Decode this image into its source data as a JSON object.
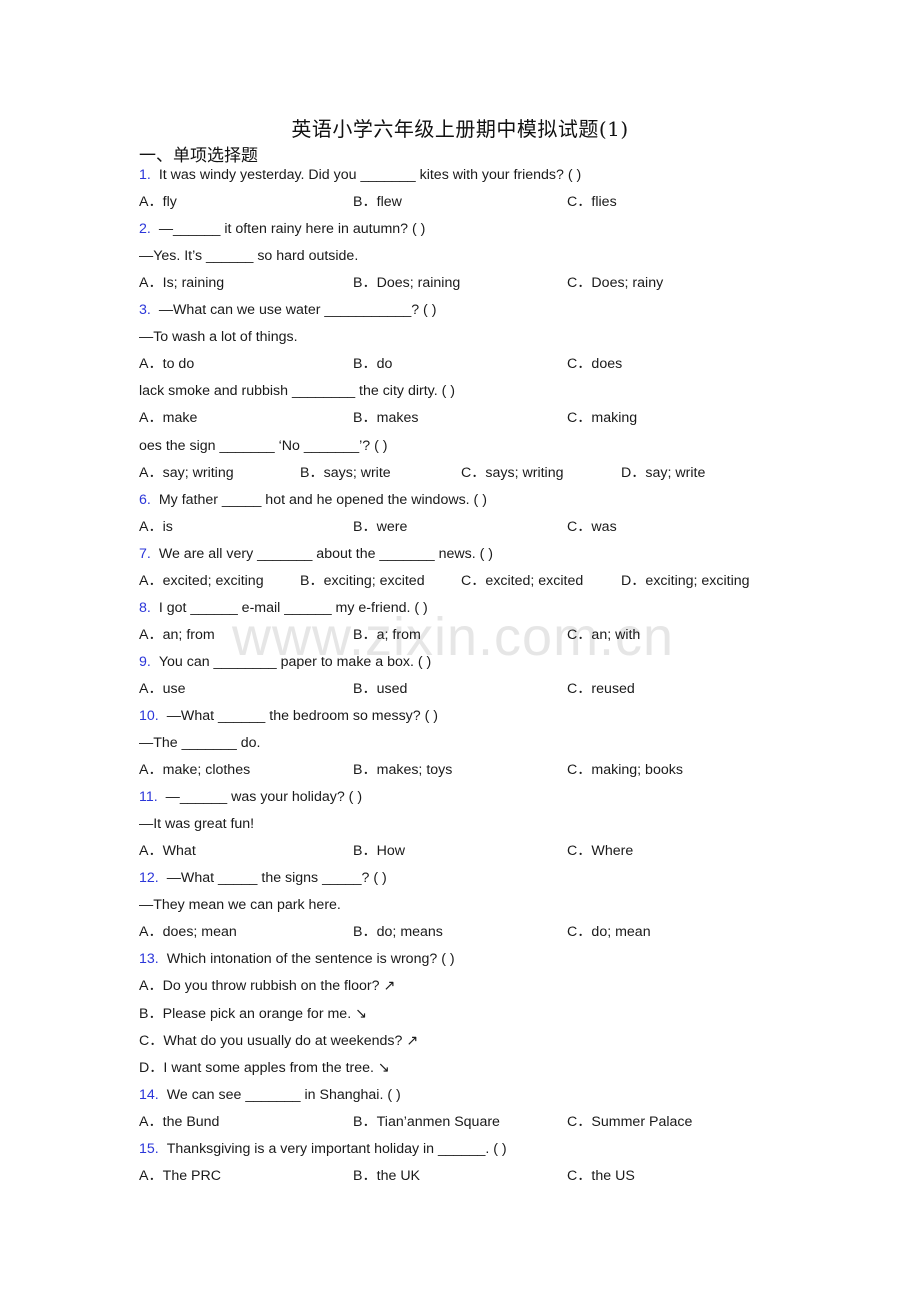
{
  "title": "英语小学六年级上册期中模拟试题(1)",
  "section": "一、单项选择题",
  "watermark": "www.zixin.com.cn",
  "colors": {
    "question_number": "#2b36d9",
    "text": "#1a1a1a",
    "watermark": "#c8c8c8"
  },
  "questions": [
    {
      "num": "1.",
      "stem": "It was windy yesterday. Did you _______ kites with your friends? (     )",
      "options": [
        "A．fly",
        "B．flew",
        "C．flies"
      ]
    },
    {
      "num": "2.",
      "stem": "—______ it often rainy here in autumn? (    )",
      "reply": "—Yes. It’s ______ so hard outside.",
      "options": [
        "A．Is; raining",
        "B．Does; raining",
        "C．Does; rainy"
      ]
    },
    {
      "num": "3.",
      "stem": "—What can we use water ___________? (    )",
      "reply": "—To wash a lot of things.",
      "options": [
        "A．to do",
        "B．do",
        "C．does"
      ]
    },
    {
      "num": "",
      "stem": "lack smoke and rubbish ________ the city dirty. (     )",
      "options": [
        "A．make",
        "B．makes",
        "C．making"
      ]
    },
    {
      "num": "",
      "stem": "oes the sign _______ ‘No _______’? (    )",
      "options": [
        "A．say; writing",
        "B．says; write",
        "C．says; writing",
        "D．say; write"
      ]
    },
    {
      "num": "6.",
      "stem": "My father _____ hot and he opened the windows. (    )",
      "options": [
        "A．is",
        "B．were",
        "C．was"
      ]
    },
    {
      "num": "7.",
      "stem": "We are all very _______ about the _______ news. (   )",
      "options": [
        "A．excited; exciting",
        "B．exciting; excited",
        "C．excited; excited",
        "D．exciting; exciting"
      ]
    },
    {
      "num": "8.",
      "stem": "I got ______ e-mail ______ my e-friend. (   )",
      "options": [
        "A．an; from",
        "B．a; from",
        "C．an; with"
      ]
    },
    {
      "num": "9.",
      "stem": "You can ________ paper to make a box. (     )",
      "options": [
        "A．use",
        "B．used",
        "C．reused"
      ]
    },
    {
      "num": "10.",
      "stem": "—What ______ the bedroom so messy? (    )",
      "reply": "—The _______ do.",
      "options": [
        "A．make; clothes",
        "B．makes; toys",
        "C．making; books"
      ]
    },
    {
      "num": "11.",
      "stem": "—______ was your holiday? (   )",
      "reply": "—It was great fun!",
      "options": [
        "A．What",
        "B．How",
        "C．Where"
      ]
    },
    {
      "num": "12.",
      "stem": "—What _____ the signs _____? (    )",
      "reply": "—They mean we can park here.",
      "options": [
        "A．does; mean",
        "B．do; means",
        "C．do; mean"
      ]
    },
    {
      "num": "13.",
      "stem": "Which intonation of the sentence is wrong? (    )",
      "options_stacked": [
        "A．Do you throw rubbish on the floor? ↗",
        "B．Please pick an orange for me. ↘",
        "C．What do you usually do at weekends? ↗",
        "D．I want some apples from the tree. ↘"
      ]
    },
    {
      "num": "14.",
      "stem": "We can see _______ in Shanghai. (   )",
      "options": [
        "A．the Bund",
        "B．Tian’anmen Square",
        "C．Summer Palace"
      ]
    },
    {
      "num": "15.",
      "stem": "Thanksgiving is a very important holiday in ______. (    )",
      "options": [
        "A．The PRC",
        "B．the UK",
        "C．the US"
      ]
    }
  ]
}
